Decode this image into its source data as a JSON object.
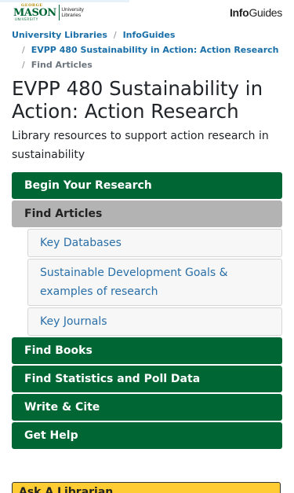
{
  "header": {
    "logo": {
      "george": "GEORGE",
      "mason": "MASON",
      "university": "UNIVERSITY",
      "libraries": "University Libraries"
    },
    "infoguides_logo": {
      "info": "Info",
      "guides": "Guides"
    },
    "loading_progress": 0.44
  },
  "breadcrumb": {
    "items": [
      "University Libraries",
      "InfoGuides",
      "EVPP 480 Sustainability in Action: Action Research",
      "Find Articles"
    ],
    "separator": "/"
  },
  "page": {
    "title": "EVPP 480 Sustainability in Action: Action Research",
    "description": "Library resources to support action research in sustainability"
  },
  "nav": {
    "items": [
      {
        "label": "Begin Your Research"
      },
      {
        "label": "Find Articles"
      },
      {
        "label": "Find Books"
      },
      {
        "label": "Find Statistics and Poll Data"
      },
      {
        "label": "Write & Cite"
      },
      {
        "label": "Get Help"
      }
    ],
    "subitems": [
      {
        "label": "Key Databases"
      },
      {
        "label": "Sustainable Development Goals & examples of research"
      },
      {
        "label": "Key Journals"
      }
    ]
  },
  "ask": {
    "label": "Ask A Librarian"
  },
  "colors": {
    "brand_green": "#006633",
    "active_gray": "#b3b3b3",
    "link_blue": "#1a6fa8",
    "ask_gold": "#ffcc33"
  }
}
